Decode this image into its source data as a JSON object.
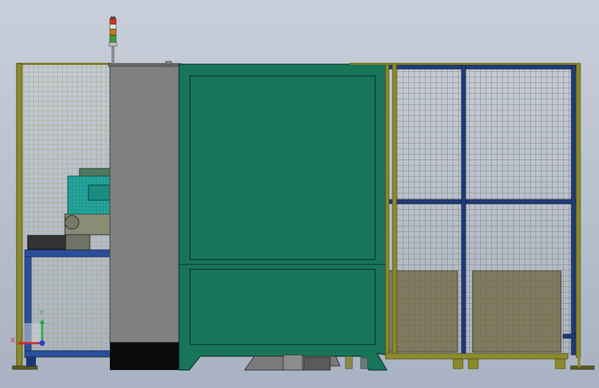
{
  "scene": {
    "background_top": "#c9cfda",
    "background_bottom": "#a9b2c2"
  },
  "colors": {
    "left_mesh": "#9c9a3a",
    "left_post": "#7d7a24",
    "grey_panel": "#808080",
    "green_door": "#18755a",
    "blue_frame": "#1f3b7a",
    "right_mesh": "#7a6f3c",
    "tan_box": "#7f7a60",
    "black_base": "#0a0a0a",
    "teal_machine": "#23a59c",
    "beacon_red": "#d2312a",
    "beacon_orange": "#c8771c",
    "beacon_green": "#3c9d3c",
    "axis_x": "#d12a2a",
    "axis_y": "#2aa64a",
    "axis_z": "#2a3fd1"
  },
  "triad": {
    "x_label": "X",
    "y_label": "Y"
  },
  "icons": {
    "beacon": "signal-tower-icon",
    "triad": "coordinate-triad-icon"
  }
}
